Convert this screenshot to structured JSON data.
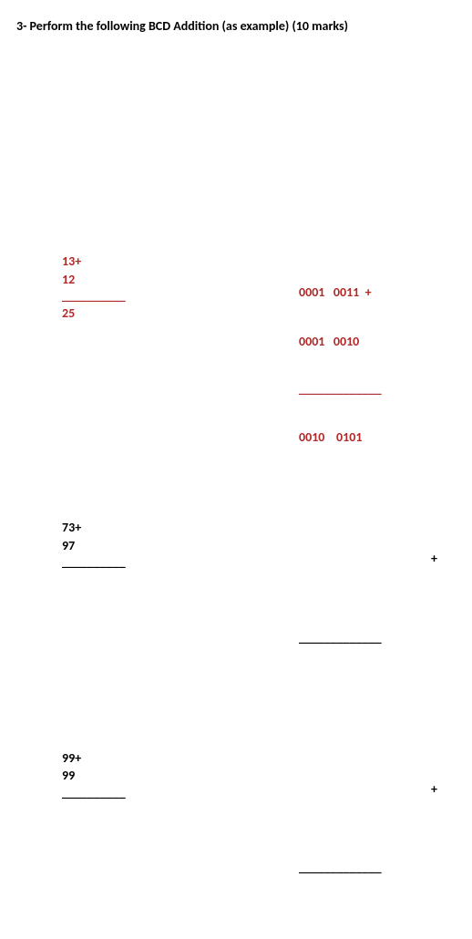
{
  "title": "3- Perform the following BCD Addition (as example) (10 marks)",
  "problems": [
    {
      "color": "red",
      "decimal": {
        "line1": "13+",
        "line2": "12",
        "rule": "__________",
        "result": "25"
      },
      "bcd": {
        "line1": "0001   0011  +",
        "line2": "0001   0010",
        "rule": "_____________",
        "result": "0010    0101"
      }
    },
    {
      "color": "black",
      "decimal": {
        "line1": "73+",
        "line2": "97",
        "rule": "__________",
        "result": ""
      },
      "bcd": {
        "line1plus": "+",
        "line2": "",
        "rule": "_____________",
        "result": ""
      }
    },
    {
      "color": "black",
      "decimal": {
        "line1": "99+",
        "line2": "99",
        "rule": "__________",
        "result": ""
      },
      "bcd": {
        "line1plus": "+",
        "line2": "",
        "rule": "_____________",
        "result": ""
      }
    }
  ]
}
